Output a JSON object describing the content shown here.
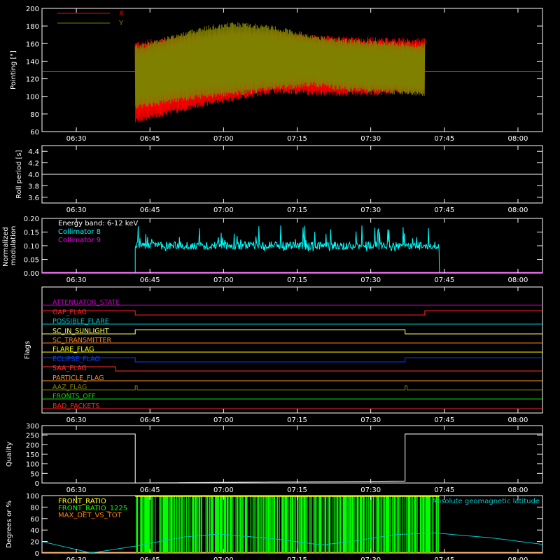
{
  "chart_data": [
    {
      "type": "line",
      "panel": "pointing",
      "ylabel": "Pointing [\"]",
      "ylim": [
        60,
        200
      ],
      "yticks": [
        60,
        80,
        100,
        120,
        140,
        160,
        180,
        200
      ],
      "xticks": [
        "06:30",
        "06:45",
        "07:00",
        "07:15",
        "07:30",
        "07:45",
        "08:00"
      ],
      "xlim_minutes": [
        383,
        485
      ],
      "legend": "top-left",
      "series": [
        {
          "name": "X",
          "color": "#ff0000",
          "baseline": 128,
          "active_range": [
            "06:42",
            "07:41"
          ],
          "upper": [
            [
              402,
              160
            ],
            [
              415,
              170
            ],
            [
              430,
              172
            ],
            [
              438,
              167
            ],
            [
              445,
              165
            ],
            [
              461,
              163
            ]
          ],
          "lower": [
            [
              402,
              72
            ],
            [
              415,
              90
            ],
            [
              430,
              106
            ],
            [
              438,
              104
            ],
            [
              445,
              103
            ],
            [
              461,
              106
            ]
          ]
        },
        {
          "name": "Y",
          "color": "#808000",
          "baseline": 128,
          "active_range": [
            "06:42",
            "07:41"
          ],
          "upper": [
            [
              402,
              155
            ],
            [
              415,
              176
            ],
            [
              422,
              182
            ],
            [
              430,
              178
            ],
            [
              438,
              168
            ],
            [
              445,
              163
            ],
            [
              461,
              158
            ]
          ],
          "lower": [
            [
              402,
              88
            ],
            [
              415,
              100
            ],
            [
              425,
              105
            ],
            [
              438,
              114
            ],
            [
              445,
              108
            ],
            [
              461,
              103
            ]
          ]
        }
      ]
    },
    {
      "type": "line",
      "panel": "roll-period",
      "ylabel": "Roll period [s]",
      "ylim": [
        3.5,
        4.5
      ],
      "yticks": [
        "3.6",
        "3.8",
        "4.0",
        "4.2",
        "4.4"
      ],
      "xticks": [
        "06:30",
        "06:45",
        "07:00",
        "07:15",
        "07:30",
        "07:45",
        "08:00"
      ],
      "series": [
        {
          "value": 4.0,
          "color": "#ffffff"
        }
      ]
    },
    {
      "type": "line",
      "panel": "modulation",
      "ylabel": "Normalized modulation",
      "ylim": [
        0,
        0.2
      ],
      "yticks": [
        "0.00",
        "0.05",
        "0.10",
        "0.15",
        "0.20"
      ],
      "xticks": [
        "06:30",
        "06:45",
        "07:00",
        "07:15",
        "07:30",
        "07:45",
        "08:00"
      ],
      "legend_title": "Energy band: 6-12 keV",
      "series": [
        {
          "name": "Collimator 8",
          "color": "#00ffff",
          "mean": 0.1,
          "active_range": [
            "06:42",
            "07:44"
          ]
        },
        {
          "name": "Collimator 9",
          "color": "#ff00ff",
          "value": 0.0
        }
      ]
    },
    {
      "type": "line",
      "panel": "flags",
      "ylabel": "Flags",
      "xticks": [
        "06:30",
        "06:45",
        "07:00",
        "07:15",
        "07:30",
        "07:45",
        "08:00"
      ],
      "series": [
        {
          "name": "ATTENUATOR_STATE",
          "color": "#c000c0",
          "segments": []
        },
        {
          "name": "GAP_FLAG",
          "color": "#ff2020",
          "segments": [
            [
              383,
              1
            ],
            [
              402,
              0
            ],
            [
              461,
              1
            ]
          ]
        },
        {
          "name": "POSSIBLE_FLARE",
          "color": "#00c8c8",
          "segments": []
        },
        {
          "name": "SC_IN_SUNLIGHT",
          "color": "#ffff60",
          "segments": [
            [
              383,
              0
            ],
            [
              402,
              1
            ],
            [
              457,
              0
            ]
          ]
        },
        {
          "name": "SC_TRANSMITTER",
          "color": "#ff8020",
          "segments": []
        },
        {
          "name": "FLARE_FLAG",
          "color": "#ffff00",
          "segments": []
        },
        {
          "name": "ECLIPSE_FLAG",
          "color": "#0040ff",
          "segments": [
            [
              383,
              1
            ],
            [
              402,
              0
            ],
            [
              457,
              1
            ]
          ]
        },
        {
          "name": "SAA_FLAG",
          "color": "#ff3030",
          "segments": [
            [
              383,
              1
            ],
            [
              398,
              0
            ]
          ]
        },
        {
          "name": "PARTICLE_FLAG",
          "color": "#ff9020",
          "segments": []
        },
        {
          "name": "AAZ_FLAG",
          "color": "#808000",
          "segments": [
            [
              383,
              0
            ],
            [
              402,
              1
            ],
            [
              402.4,
              0
            ],
            [
              457,
              1
            ],
            [
              457.4,
              0
            ]
          ]
        },
        {
          "name": "FRONTS_OFF",
          "color": "#00e000",
          "segments": []
        },
        {
          "name": "BAD_PACKETS",
          "color": "#ff2020",
          "segments": []
        }
      ]
    },
    {
      "type": "line",
      "panel": "quality",
      "ylabel": "Quality",
      "ylim": [
        0,
        300
      ],
      "yticks": [
        "0",
        "50",
        "100",
        "150",
        "200",
        "250",
        "300"
      ],
      "xticks": [
        "06:30",
        "06:45",
        "07:00",
        "07:15",
        "07:30",
        "07:45",
        "08:00"
      ],
      "series": [
        {
          "color": "#ffffff",
          "points": [
            [
              383,
              256
            ],
            [
              402,
              256
            ],
            [
              402,
              0
            ],
            [
              457,
              10
            ],
            [
              457,
              256
            ],
            [
              485,
              256
            ]
          ]
        }
      ]
    },
    {
      "type": "bar",
      "panel": "ratios",
      "ylabel": "Degrees or %",
      "ylim": [
        0,
        100
      ],
      "yticks": [
        "0",
        "20",
        "40",
        "60",
        "80",
        "100"
      ],
      "xticks": [
        "06:30",
        "06:45",
        "07:00",
        "07:15",
        "07:30",
        "07:45",
        "08:00"
      ],
      "legend": "top-left",
      "series": [
        {
          "name": "FRONT_RATIO",
          "color": "#ffff00",
          "value": 100,
          "active_range": [
            "06:42",
            "07:44"
          ]
        },
        {
          "name": "FRONT_RATIO_1225",
          "color": "#00ff00",
          "value": 100,
          "active_range": [
            "06:42",
            "07:44"
          ]
        },
        {
          "name": "MAX_DET_VS_TOT",
          "color": "#ff8000",
          "value": 0
        },
        {
          "name": "Absolute geomagnetic latitude",
          "color": "#00c8c8",
          "points": [
            [
              383,
              20
            ],
            [
              388,
              10
            ],
            [
              393,
              0
            ],
            [
              402,
              12
            ],
            [
              412,
              28
            ],
            [
              419,
              33
            ],
            [
              430,
              25
            ],
            [
              440,
              14
            ],
            [
              446,
              20
            ],
            [
              455,
              32
            ],
            [
              463,
              35
            ],
            [
              475,
              26
            ],
            [
              485,
              15
            ]
          ]
        }
      ]
    }
  ]
}
